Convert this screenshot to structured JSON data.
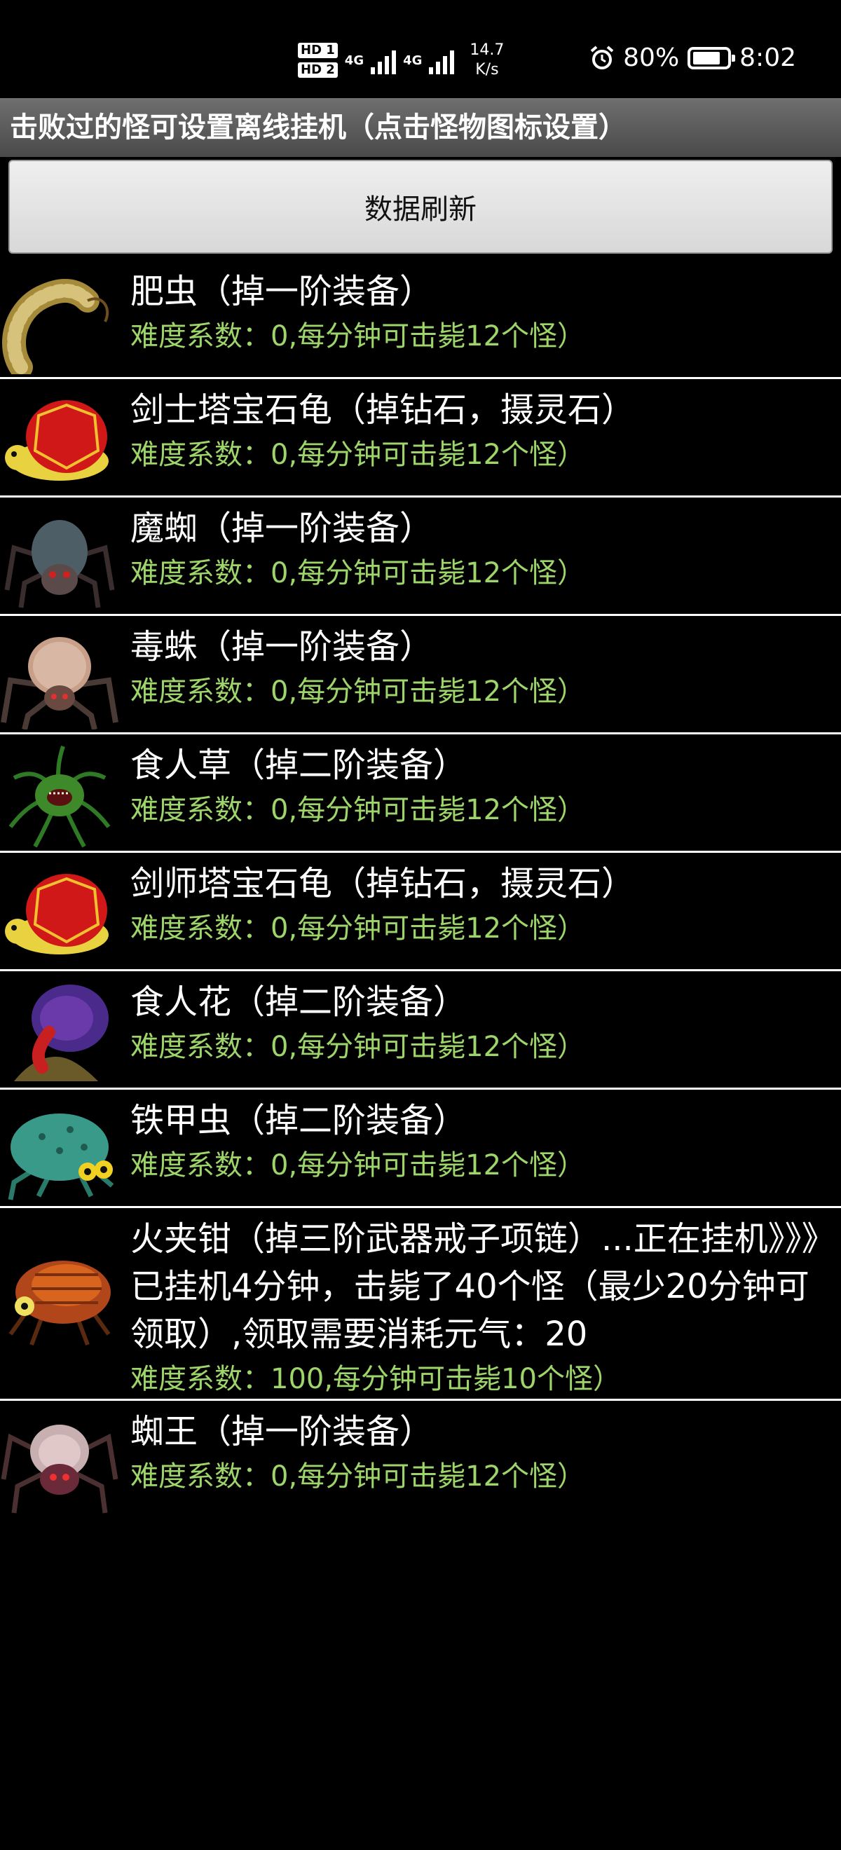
{
  "status_bar": {
    "hd1": "HD 1",
    "hd2": "HD 2",
    "net1": "4G",
    "net2": "4G",
    "speed_value": "14.7",
    "speed_unit": "K/s",
    "battery": "80%",
    "time": "8:02",
    "icons": [
      "alarm-icon",
      "battery-icon",
      "signal-icon"
    ]
  },
  "title": "击败过的怪可设置离线挂机（点击怪物图标设置）",
  "refresh_label": "数据刷新",
  "monsters": [
    {
      "name": "肥虫（掉一阶装备）",
      "difficulty": "难度系数：0,每分钟可击毙12个怪）",
      "icon": "fat-worm-icon"
    },
    {
      "name": "剑士塔宝石龟（掉钻石，摄灵石）",
      "difficulty": "难度系数：0,每分钟可击毙12个怪）",
      "icon": "gem-turtle-icon"
    },
    {
      "name": "魔蜘（掉一阶装备）",
      "difficulty": "难度系数：0,每分钟可击毙12个怪）",
      "icon": "demon-spider-icon"
    },
    {
      "name": "毒蛛（掉一阶装备）",
      "difficulty": "难度系数：0,每分钟可击毙12个怪）",
      "icon": "poison-spider-icon"
    },
    {
      "name": "食人草（掉二阶装备）",
      "difficulty": "难度系数：0,每分钟可击毙12个怪）",
      "icon": "maneater-grass-icon"
    },
    {
      "name": "剑师塔宝石龟（掉钻石，摄灵石）",
      "difficulty": "难度系数：0,每分钟可击毙12个怪）",
      "icon": "gem-turtle-icon"
    },
    {
      "name": "食人花（掉二阶装备）",
      "difficulty": "难度系数：0,每分钟可击毙12个怪）",
      "icon": "maneater-flower-icon"
    },
    {
      "name": "铁甲虫（掉二阶装备）",
      "difficulty": "难度系数：0,每分钟可击毙12个怪）",
      "icon": "iron-beetle-icon"
    },
    {
      "name": "火夹钳（掉三阶武器戒子项链）...正在挂机》》》已挂机4分钟，击毙了40个怪（最少20分钟可领取）,领取需要消耗元气：20",
      "difficulty": "难度系数：100,每分钟可击毙10个怪）",
      "icon": "fire-crab-icon"
    },
    {
      "name": "蜘王（掉一阶装备）",
      "difficulty": "难度系数：0,每分钟可击毙12个怪）",
      "icon": "spider-king-icon"
    }
  ]
}
